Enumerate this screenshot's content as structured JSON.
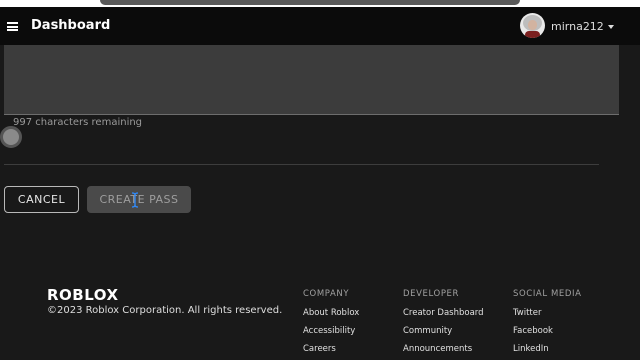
{
  "header": {
    "title": "Dashboard",
    "username": "mirna212"
  },
  "form": {
    "chars_remaining": "997 characters remaining",
    "cancel_label": "CANCEL",
    "create_label": "CREATE PASS"
  },
  "footer": {
    "logo": "ROBLOX",
    "copyright": "©2023 Roblox Corporation. All rights reserved.",
    "columns": [
      {
        "heading": "COMPANY",
        "links": [
          "About Roblox",
          "Accessibility",
          "Careers"
        ]
      },
      {
        "heading": "DEVELOPER",
        "links": [
          "Creator Dashboard",
          "Community",
          "Announcements"
        ]
      },
      {
        "heading": "SOCIAL MEDIA",
        "links": [
          "Twitter",
          "Facebook",
          "LinkedIn"
        ]
      }
    ]
  },
  "icons": {
    "menu": "menu-icon",
    "dropdown": "caret-down-icon",
    "cursor": "text-cursor-icon"
  },
  "colors": {
    "background": "#191919",
    "header": "#0b0b0b",
    "textarea": "#3c3c3c",
    "create_button": "#4a4a4a"
  }
}
